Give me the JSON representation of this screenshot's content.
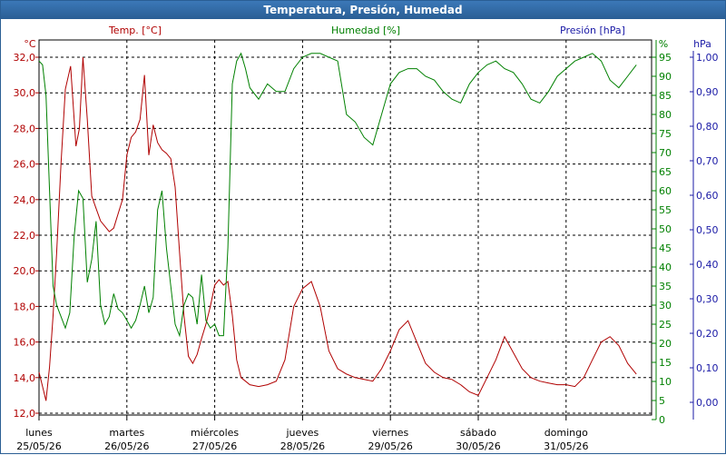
{
  "window": {
    "title": "Temperatura, Presión, Humedad"
  },
  "colors": {
    "temperature": "#b00000",
    "humidity": "#008000",
    "pressure": "#1a1aa6",
    "grid": "#000000"
  },
  "chart_data": {
    "type": "line",
    "title": "Temperatura, Presión, Humedad",
    "grid": true,
    "x_ticks": [
      {
        "day": "lunes",
        "date": "25/05/26"
      },
      {
        "day": "martes",
        "date": "26/05/26"
      },
      {
        "day": "miércoles",
        "date": "27/05/26"
      },
      {
        "day": "jueves",
        "date": "28/05/26"
      },
      {
        "day": "viernes",
        "date": "29/05/26"
      },
      {
        "day": "sábado",
        "date": "30/05/26"
      },
      {
        "day": "domingo",
        "date": "31/05/26"
      }
    ],
    "axes": {
      "temperature": {
        "label": "Temp. [°C]",
        "unit": "°C",
        "range": [
          12,
          33
        ],
        "ticks": [
          "32,0",
          "30,0",
          "28,0",
          "26,0",
          "24,0",
          "22,0",
          "20,0",
          "18,0",
          "16,0",
          "14,0",
          "12,0"
        ]
      },
      "humidity": {
        "label": "Humedad [%]",
        "unit": "%",
        "range": [
          0,
          100
        ],
        "ticks": [
          "95",
          "90",
          "85",
          "80",
          "75",
          "70",
          "65",
          "60",
          "55",
          "50",
          "45",
          "40",
          "35",
          "30",
          "25",
          "20",
          "15",
          "10",
          "5",
          "0"
        ]
      },
      "pressure": {
        "label": "Presión [hPa]",
        "unit": "hPa",
        "range": [
          -0.05,
          1.0
        ],
        "ticks": [
          "1,00",
          "0,90",
          "0,80",
          "0,70",
          "0,60",
          "0,50",
          "0,40",
          "0,30",
          "0,20",
          "0,10",
          "0,00"
        ]
      }
    },
    "series": [
      {
        "name": "Temp. [°C]",
        "axis": "temperature",
        "x": [
          0,
          0.04,
          0.08,
          0.12,
          0.16,
          0.2,
          0.25,
          0.3,
          0.36,
          0.42,
          0.46,
          0.5,
          0.55,
          0.6,
          0.65,
          0.7,
          0.75,
          0.8,
          0.85,
          0.9,
          0.95,
          1.0,
          1.05,
          1.1,
          1.15,
          1.2,
          1.25,
          1.3,
          1.35,
          1.4,
          1.45,
          1.5,
          1.55,
          1.6,
          1.65,
          1.7,
          1.75,
          1.8,
          1.85,
          1.9,
          1.95,
          2.0,
          2.05,
          2.1,
          2.15,
          2.2,
          2.25,
          2.3,
          2.35,
          2.4,
          2.5,
          2.6,
          2.7,
          2.8,
          2.9,
          3.0,
          3.1,
          3.2,
          3.3,
          3.4,
          3.5,
          3.6,
          3.7,
          3.8,
          3.9,
          4.0,
          4.1,
          4.2,
          4.3,
          4.4,
          4.5,
          4.6,
          4.7,
          4.8,
          4.9,
          5.0,
          5.1,
          5.2,
          5.3,
          5.4,
          5.5,
          5.6,
          5.7,
          5.8,
          5.9,
          6.0,
          6.1,
          6.2,
          6.3,
          6.4,
          6.5,
          6.6,
          6.7,
          6.8
        ],
        "values": [
          14.3,
          13.5,
          12.7,
          14.6,
          17.5,
          21.0,
          26.0,
          30.2,
          31.5,
          27.0,
          28.0,
          32.0,
          28.5,
          24.2,
          23.5,
          22.8,
          22.5,
          22.2,
          22.4,
          23.2,
          24.0,
          26.5,
          27.5,
          27.8,
          28.5,
          31.0,
          26.5,
          28.2,
          27.2,
          26.8,
          26.6,
          26.3,
          24.7,
          21.0,
          17.5,
          15.2,
          14.8,
          15.3,
          16.2,
          17.0,
          18.0,
          19.2,
          19.5,
          19.2,
          19.4,
          17.5,
          15.0,
          14.0,
          13.8,
          13.6,
          13.5,
          13.6,
          13.8,
          15.0,
          18.0,
          19.0,
          19.4,
          18.0,
          15.5,
          14.5,
          14.2,
          14.0,
          13.9,
          13.8,
          14.5,
          15.5,
          16.7,
          17.2,
          16.0,
          14.8,
          14.3,
          14.0,
          13.9,
          13.6,
          13.2,
          13.0,
          14.0,
          15.0,
          16.3,
          15.4,
          14.5,
          14.0,
          13.8,
          13.7,
          13.6,
          13.6,
          13.5,
          14.0,
          15.0,
          16.0,
          16.3,
          15.8,
          14.8,
          14.2
        ]
      },
      {
        "name": "Humedad [%]",
        "axis": "humidity",
        "x": [
          0,
          0.04,
          0.08,
          0.12,
          0.16,
          0.2,
          0.25,
          0.3,
          0.35,
          0.4,
          0.45,
          0.5,
          0.55,
          0.6,
          0.65,
          0.7,
          0.75,
          0.8,
          0.85,
          0.9,
          0.95,
          1.0,
          1.05,
          1.1,
          1.15,
          1.2,
          1.25,
          1.3,
          1.35,
          1.4,
          1.45,
          1.5,
          1.55,
          1.6,
          1.65,
          1.7,
          1.75,
          1.8,
          1.85,
          1.9,
          1.95,
          2.0,
          2.05,
          2.1,
          2.15,
          2.2,
          2.25,
          2.3,
          2.35,
          2.4,
          2.5,
          2.6,
          2.7,
          2.8,
          2.9,
          3.0,
          3.1,
          3.2,
          3.3,
          3.4,
          3.5,
          3.6,
          3.7,
          3.8,
          3.9,
          4.0,
          4.1,
          4.2,
          4.3,
          4.4,
          4.5,
          4.6,
          4.7,
          4.8,
          4.9,
          5.0,
          5.1,
          5.2,
          5.3,
          5.4,
          5.5,
          5.6,
          5.7,
          5.8,
          5.9,
          6.0,
          6.1,
          6.2,
          6.3,
          6.4,
          6.5,
          6.6,
          6.7,
          6.8
        ],
        "values": [
          94,
          93,
          85,
          60,
          35,
          30,
          27,
          24,
          28,
          48,
          60,
          58,
          36,
          42,
          52,
          30,
          25,
          27,
          33,
          29,
          28,
          26,
          24,
          26,
          30,
          35,
          28,
          32,
          55,
          60,
          45,
          35,
          25,
          22,
          30,
          33,
          32,
          25,
          38,
          26,
          24,
          25,
          22,
          22,
          45,
          88,
          94,
          96,
          92,
          87,
          84,
          88,
          86,
          86,
          92,
          95,
          96,
          96,
          95,
          94,
          80,
          78,
          74,
          72,
          80,
          88,
          91,
          92,
          92,
          90,
          89,
          86,
          84,
          83,
          88,
          91,
          93,
          94,
          92,
          91,
          88,
          84,
          83,
          86,
          90,
          92,
          94,
          95,
          96,
          94,
          89,
          87,
          90,
          93
        ]
      },
      {
        "name": "Presión [hPa]",
        "axis": "pressure",
        "x": [],
        "values": []
      }
    ]
  }
}
